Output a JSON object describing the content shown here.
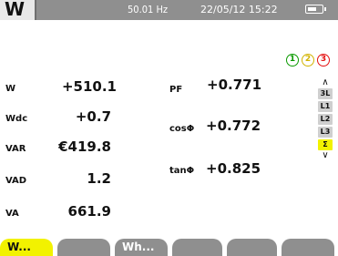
{
  "status": {
    "mode_glyph": "W",
    "frequency": "50.01 Hz",
    "datetime": "22/05/12 15:22",
    "battery_level": 0.7
  },
  "phases": [
    {
      "label": "1",
      "color": "#0a9a00"
    },
    {
      "label": "2",
      "color": "#d2b300"
    },
    {
      "label": "3",
      "color": "#e41010"
    }
  ],
  "left_measurements": [
    {
      "label": "W",
      "value": "+510.1"
    },
    {
      "label": "Wdc",
      "value": "+0.7"
    },
    {
      "label": "VAR",
      "value": "€419.8"
    },
    {
      "label": "VAD",
      "value": "1.2"
    },
    {
      "label": "VA",
      "value": "661.9"
    }
  ],
  "right_measurements": [
    {
      "label": "PF",
      "value": "+0.771"
    },
    {
      "label": "cosΦ",
      "value": "+0.772"
    },
    {
      "label": "tanΦ",
      "value": "+0.825"
    }
  ],
  "selector": {
    "up": "∧",
    "down": "∨",
    "items": [
      "3L",
      "L1",
      "L2",
      "L3",
      "Σ"
    ],
    "active": "Σ"
  },
  "softkeys": [
    {
      "label": "W...",
      "active": true
    },
    {
      "label": "",
      "active": false
    },
    {
      "label": "Wh...",
      "active": false
    },
    {
      "label": "",
      "active": false
    },
    {
      "label": "",
      "active": false
    },
    {
      "label": "",
      "active": false
    }
  ],
  "colors": {
    "statusbar": "#8f8f8f",
    "highlight": "#f2f200"
  }
}
